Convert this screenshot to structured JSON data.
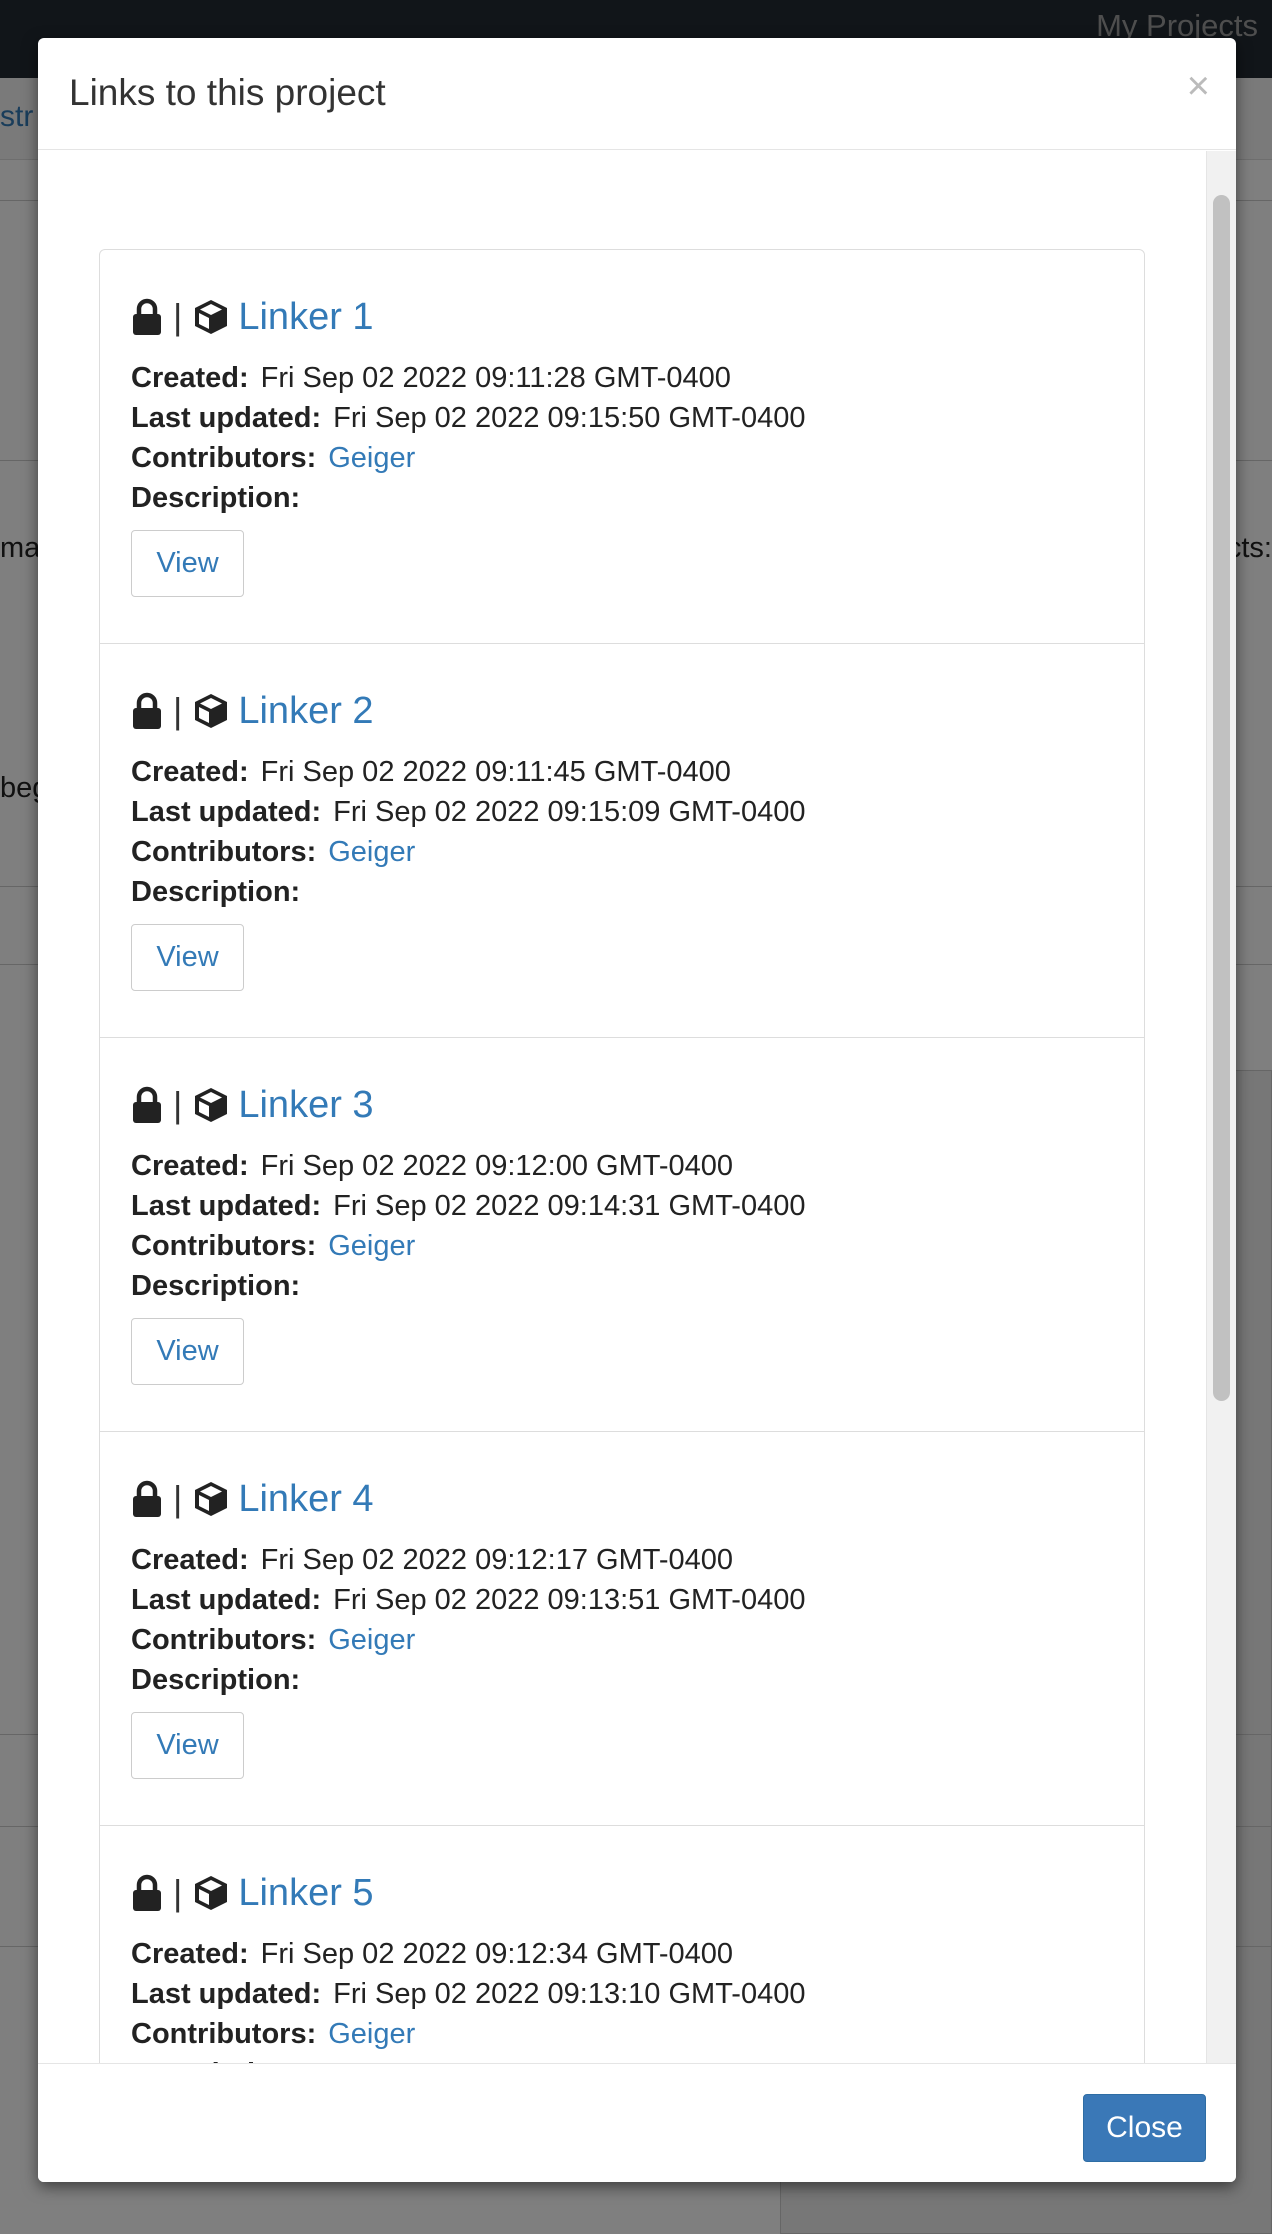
{
  "background": {
    "nav_link": "My Projects",
    "subnav_fragment": "str",
    "left_fragment_1": "ma",
    "left_fragment_2": "beg",
    "right_fragment": "cts:"
  },
  "modal": {
    "title": "Links to this project",
    "close_x": "×",
    "close_button": "Close",
    "labels": {
      "created": "Created:",
      "last_updated": "Last updated:",
      "contributors": "Contributors:",
      "description": "Description:",
      "view": "View",
      "separator": "|"
    },
    "links": [
      {
        "name": "Linker 1",
        "created": "Fri Sep 02 2022 09:11:28 GMT-0400",
        "updated": "Fri Sep 02 2022 09:15:50 GMT-0400",
        "contributor": "Geiger"
      },
      {
        "name": "Linker 2",
        "created": "Fri Sep 02 2022 09:11:45 GMT-0400",
        "updated": "Fri Sep 02 2022 09:15:09 GMT-0400",
        "contributor": "Geiger"
      },
      {
        "name": "Linker 3",
        "created": "Fri Sep 02 2022 09:12:00 GMT-0400",
        "updated": "Fri Sep 02 2022 09:14:31 GMT-0400",
        "contributor": "Geiger"
      },
      {
        "name": "Linker 4",
        "created": "Fri Sep 02 2022 09:12:17 GMT-0400",
        "updated": "Fri Sep 02 2022 09:13:51 GMT-0400",
        "contributor": "Geiger"
      },
      {
        "name": "Linker 5",
        "created": "Fri Sep 02 2022 09:12:34 GMT-0400",
        "updated": "Fri Sep 02 2022 09:13:10 GMT-0400",
        "contributor": "Geiger"
      }
    ]
  }
}
